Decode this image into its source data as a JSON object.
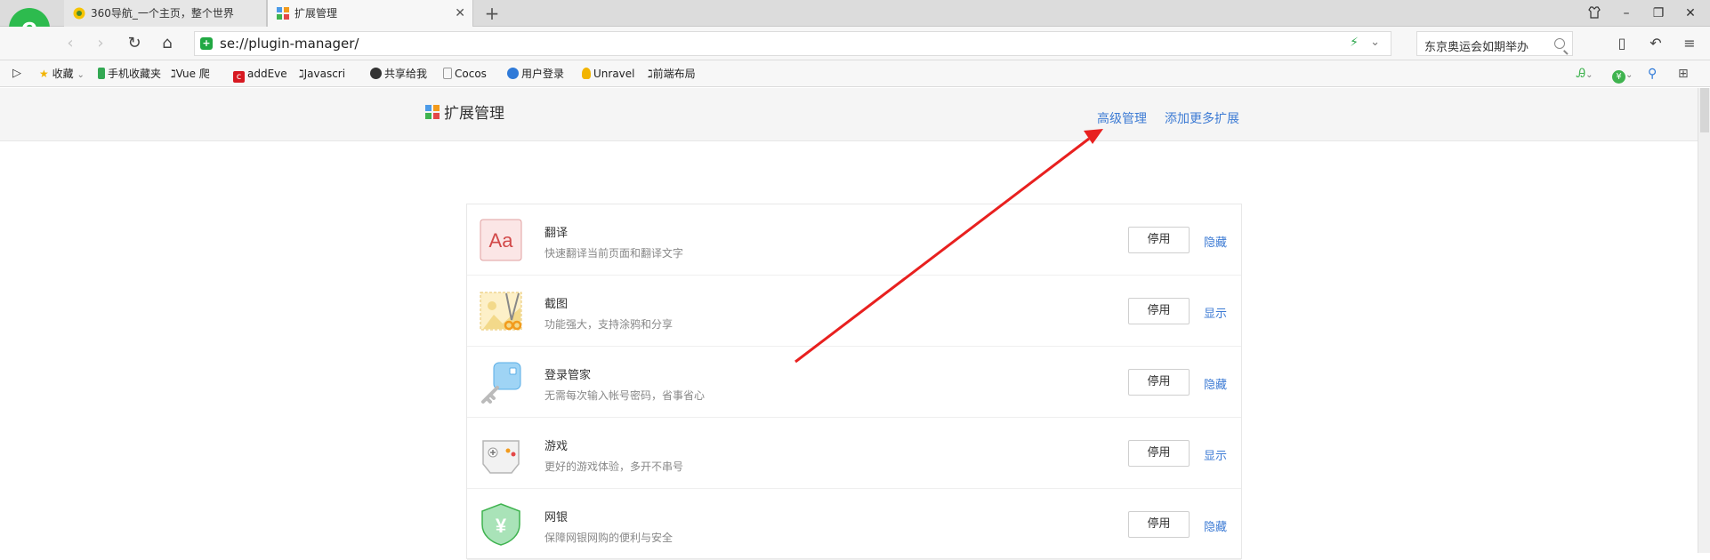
{
  "tabs": [
    {
      "title": "360导航_一个主页，整个世界",
      "active": false
    },
    {
      "title": "扩展管理",
      "active": true
    }
  ],
  "new_tab_glyph": "+",
  "address": {
    "url": "se://plugin-manager/",
    "security_glyph": "+"
  },
  "search": {
    "query": "东京奥运会如期举办"
  },
  "bookmarks": [
    {
      "label": "收藏",
      "icon": "star-icon",
      "color": "#f2b400"
    },
    {
      "label": "手机收藏夹",
      "icon": "phone-icon",
      "color": "#33a853"
    },
    {
      "label": "Vue 爬",
      "icon": "link-icon",
      "color": "#444444"
    },
    {
      "label": "addEve",
      "icon": "c-icon",
      "color": "#d71921"
    },
    {
      "label": "Javascri",
      "icon": "link-icon",
      "color": "#444444"
    },
    {
      "label": "共享给我",
      "icon": "share-icon",
      "color": "#333333"
    },
    {
      "label": "Cocos",
      "icon": "page-icon",
      "color": "#888888"
    },
    {
      "label": "用户登录",
      "icon": "globe-icon",
      "color": "#2f7ad8"
    },
    {
      "label": "Unravel",
      "icon": "bulb-icon",
      "color": "#f2b400"
    },
    {
      "label": "前端布局",
      "icon": "link-icon",
      "color": "#444444"
    }
  ],
  "page": {
    "title": "扩展管理",
    "links": {
      "advanced": "高级管理",
      "more": "添加更多扩展"
    }
  },
  "extensions": [
    {
      "name": "翻译",
      "desc": "快速翻译当前页面和翻译文字",
      "button": "停用",
      "toggle": "隐藏",
      "icon": "translate-icon",
      "icon_text": "Aa"
    },
    {
      "name": "截图",
      "desc": "功能强大，支持涂鸦和分享",
      "button": "停用",
      "toggle": "显示",
      "icon": "screenshot-icon"
    },
    {
      "name": "登录管家",
      "desc": "无需每次输入帐号密码，省事省心",
      "button": "停用",
      "toggle": "隐藏",
      "icon": "key-icon"
    },
    {
      "name": "游戏",
      "desc": "更好的游戏体验，多开不串号",
      "button": "停用",
      "toggle": "显示",
      "icon": "gamepad-icon"
    },
    {
      "name": "网银",
      "desc": "保障网银网购的便利与安全",
      "button": "停用",
      "toggle": "隐藏",
      "icon": "shield-yen-icon",
      "icon_text": "¥"
    }
  ],
  "colors": {
    "link": "#3d7bd4",
    "annotation_arrow": "#e8201f",
    "brand_green": "#21a843"
  }
}
